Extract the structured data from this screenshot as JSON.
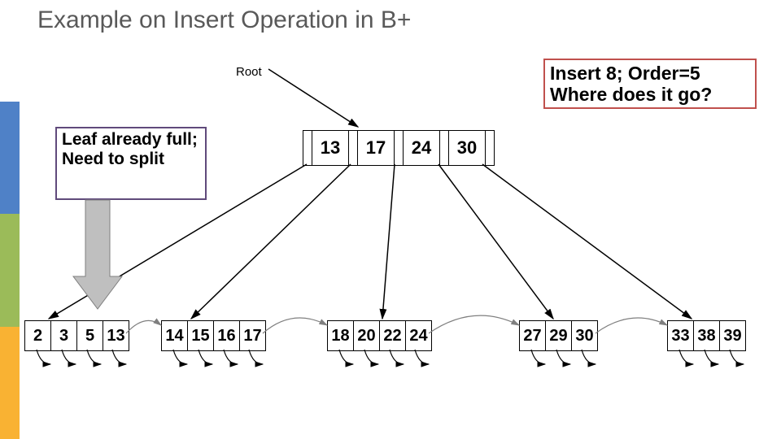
{
  "title": "Example on Insert Operation in B+",
  "root_label": "Root",
  "insert_box": "Insert 8; Order=5 Where does it go?",
  "leaf_full_box": "Leaf already full; Need to split",
  "root_node": {
    "keys": [
      "13",
      "17",
      "24",
      "30"
    ]
  },
  "leaves": [
    {
      "cells": [
        "2",
        "3",
        "5",
        "13"
      ]
    },
    {
      "cells": [
        "14",
        "15",
        "16",
        "17"
      ]
    },
    {
      "cells": [
        "18",
        "20",
        "22",
        "24"
      ]
    },
    {
      "cells": [
        "27",
        "29",
        "30"
      ]
    },
    {
      "cells": [
        "33",
        "38",
        "39"
      ]
    }
  ],
  "chart_data": {
    "type": "table",
    "title": "B+ tree before inserting key 8 (order 5)",
    "root_keys": [
      13,
      17,
      24,
      30
    ],
    "leaf_nodes": [
      [
        2,
        3,
        5,
        13
      ],
      [
        14,
        15,
        16,
        17
      ],
      [
        18,
        20,
        22,
        24
      ],
      [
        27,
        29,
        30
      ],
      [
        33,
        38,
        39
      ]
    ],
    "insert_key": 8,
    "order": 5,
    "annotations": [
      "Leaf already full; Need to split",
      "Insert 8; Order=5 Where does it go?"
    ]
  }
}
